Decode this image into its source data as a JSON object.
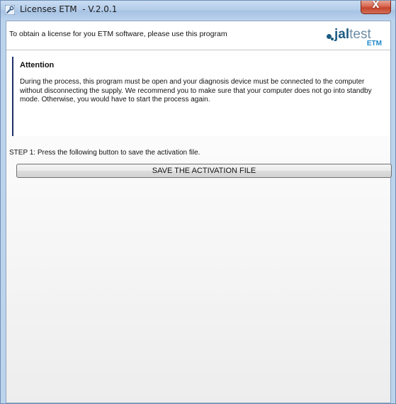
{
  "window": {
    "title": "Licenses ETM  - V.2.0.1",
    "close_glyph": "X",
    "app_icon": "wrench-icon"
  },
  "header": {
    "intro_text": "To obtain a license for you ETM software, please use this program",
    "logo": {
      "word_bold": "jal",
      "word_light": "test",
      "subtitle": "ETM",
      "brand_color": "#1c5c84",
      "accent_color": "#1f88c9"
    }
  },
  "attention": {
    "title": "Attention",
    "body": "During the process, this program must be open and your diagnosis device must be connected to the computer without disconnecting the supply. We recommend you to make sure that your computer does not go into standby mode. Otherwise, you would have to start the process again."
  },
  "step1": {
    "text": "STEP 1: Press the following button to save the activation file.",
    "button_label": "SAVE THE ACTIVATION FILE"
  }
}
